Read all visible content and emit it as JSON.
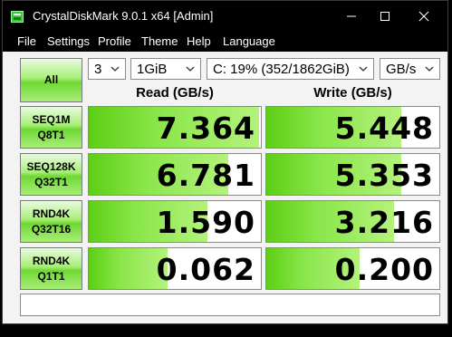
{
  "window": {
    "title": "CrystalDiskMark 9.0.1 x64 [Admin]"
  },
  "menu": [
    "File",
    "Settings",
    "Profile",
    "Theme",
    "Help",
    "Language"
  ],
  "controls": {
    "all_label": "All",
    "count": "3",
    "size": "1GiB",
    "drive": "C: 19% (352/1862GiB)",
    "unit": "GB/s"
  },
  "headers": {
    "read": "Read (GB/s)",
    "write": "Write (GB/s)"
  },
  "tests": [
    {
      "line1": "SEQ1M",
      "line2": "Q8T1",
      "read": "7.364",
      "write": "5.448",
      "read_frac": 0.99,
      "write_frac": 0.78
    },
    {
      "line1": "SEQ128K",
      "line2": "Q32T1",
      "read": "6.781",
      "write": "5.353",
      "read_frac": 0.81,
      "write_frac": 0.78
    },
    {
      "line1": "RND4K",
      "line2": "Q32T16",
      "read": "1.590",
      "write": "3.216",
      "read_frac": 0.69,
      "write_frac": 0.74
    },
    {
      "line1": "RND4K",
      "line2": "Q1T1",
      "read": "0.062",
      "write": "0.200",
      "read_frac": 0.46,
      "write_frac": 0.54
    }
  ],
  "comment": "",
  "colors": {
    "bar_green": "#6fd834",
    "title_bg": "#000000",
    "window_bg": "#f3f3f3"
  },
  "icons": {
    "app": "disk-icon",
    "minimize": "minimize-icon",
    "maximize": "maximize-icon",
    "close": "close-icon",
    "dropdown": "chevron-down-icon"
  }
}
